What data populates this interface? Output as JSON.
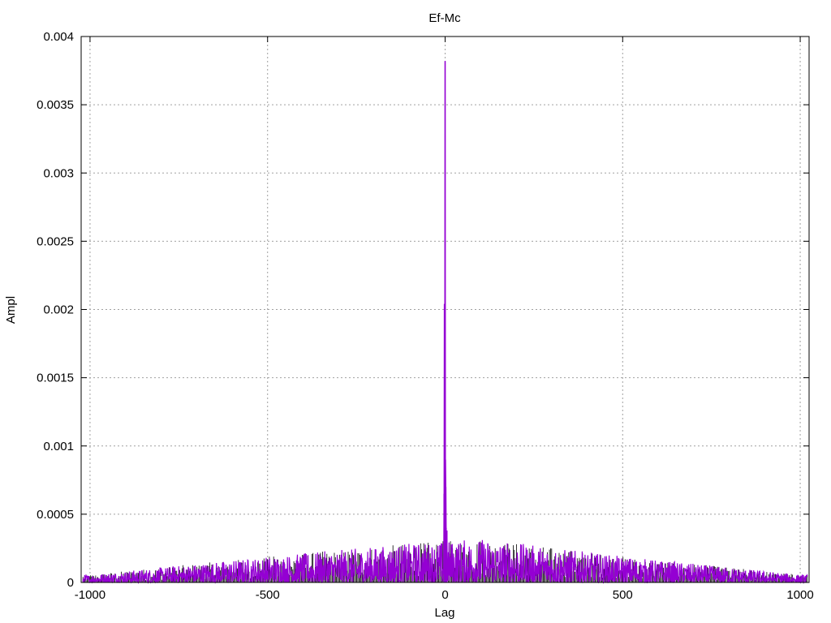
{
  "chart_data": {
    "type": "line",
    "title": "Ef-Mc",
    "xlabel": "Lag",
    "ylabel": "Ampl",
    "xlim": [
      -1025,
      1025
    ],
    "ylim": [
      0,
      0.004
    ],
    "grid": true,
    "x_ticks": [
      -1000,
      -500,
      0,
      500,
      1000
    ],
    "x_tick_labels": [
      "-1000",
      "-500",
      "0",
      "500",
      "1000"
    ],
    "y_ticks": [
      0,
      0.0005,
      0.001,
      0.0015,
      0.002,
      0.0025,
      0.003,
      0.0035,
      0.004
    ],
    "y_tick_labels": [
      "0",
      "0.0005",
      "0.001",
      "0.0015",
      "0.002",
      "0.0025",
      "0.003",
      "0.0035",
      "0.004"
    ],
    "series_color": "#9400d3",
    "secondary_color": "#000000",
    "peaks": [
      {
        "x": -3,
        "y": 0.00065
      },
      {
        "x": -2,
        "y": 0.00204
      },
      {
        "x": -1,
        "y": 0.002
      },
      {
        "x": 0,
        "y": 0.00382
      },
      {
        "x": 1,
        "y": 0.0009
      },
      {
        "x": 2,
        "y": 0.0007
      },
      {
        "x": 3,
        "y": 0.0004
      },
      {
        "x": 5,
        "y": 0.00038
      }
    ],
    "noise_envelope": [
      {
        "x": -1000,
        "y": 3e-05
      },
      {
        "x": -500,
        "y": 0.0001
      },
      {
        "x": -100,
        "y": 0.00015
      },
      {
        "x": 100,
        "y": 0.00017
      },
      {
        "x": 500,
        "y": 0.0001
      },
      {
        "x": 1000,
        "y": 3e-05
      }
    ]
  }
}
